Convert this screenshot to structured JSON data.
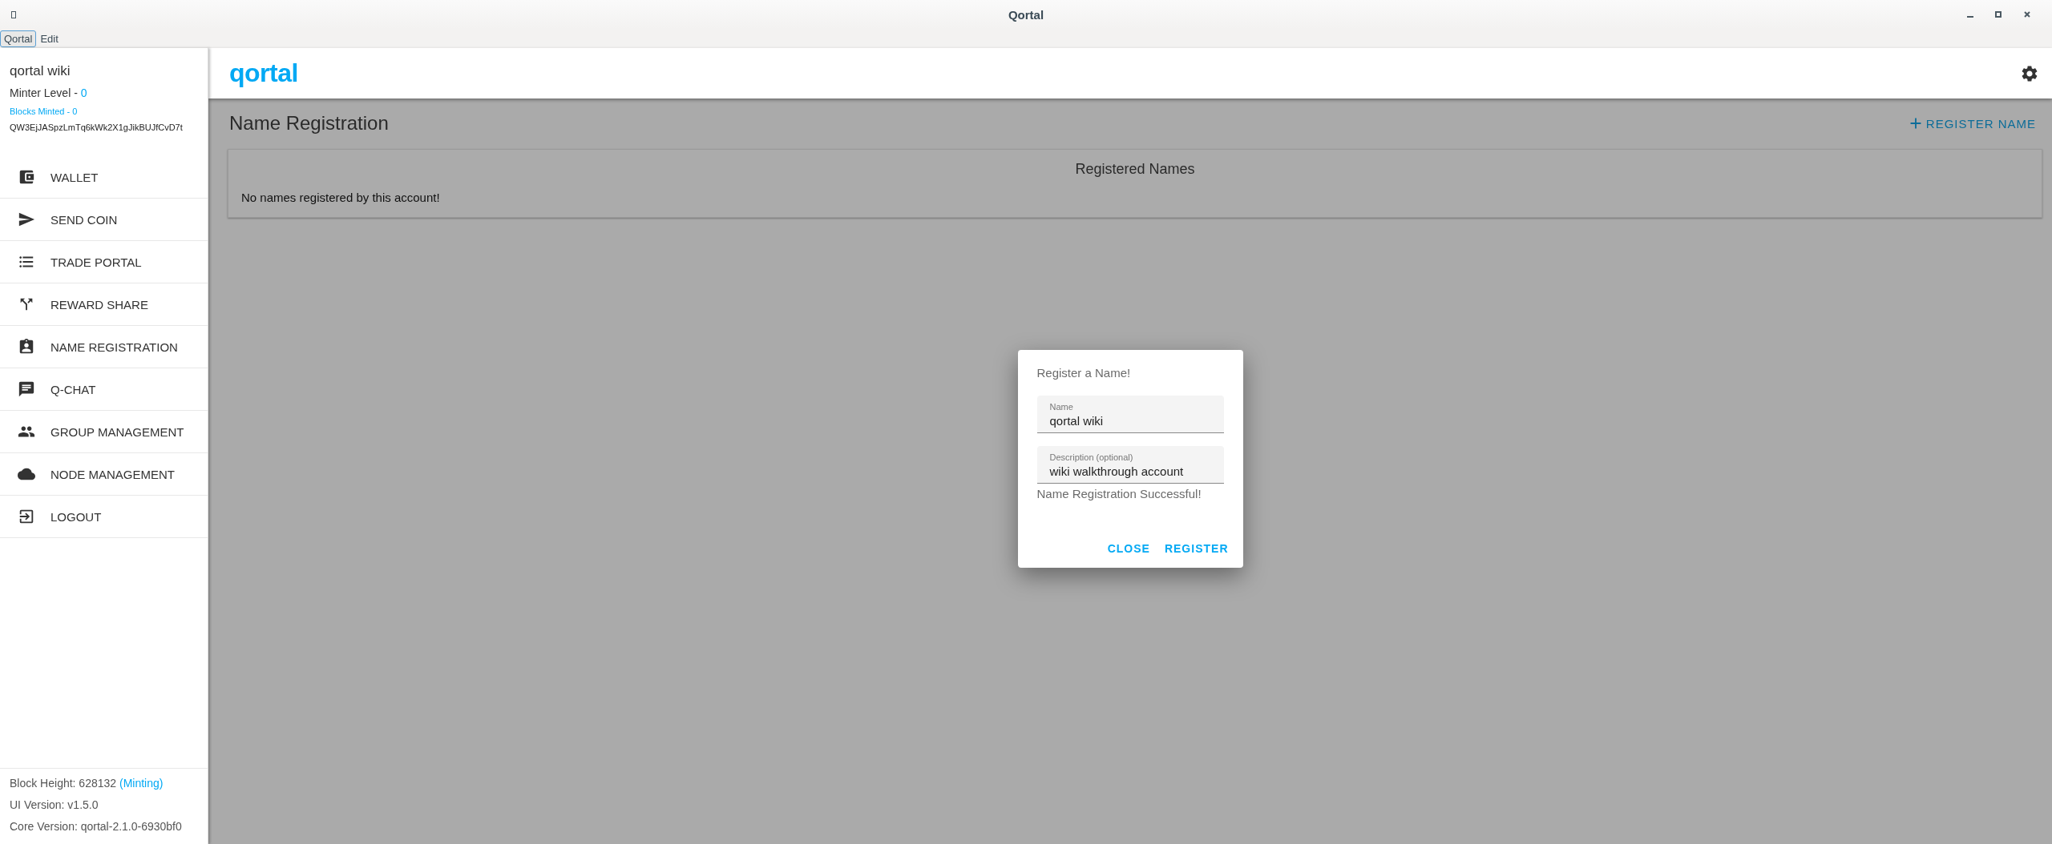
{
  "window": {
    "title": "Qortal"
  },
  "menu_bar": [
    {
      "label": "Qortal",
      "selected": true
    },
    {
      "label": "Edit",
      "selected": false
    }
  ],
  "sidebar": {
    "account_name": "qortal wiki",
    "minter_level_label": "Minter Level - ",
    "minter_level": "0",
    "blocks_minted": "Blocks Minted - 0",
    "address": "QW3EjJASpzLmTq6kWk2X1gJikBUJfCvD7t",
    "items": [
      {
        "kind": "wallet",
        "label": "WALLET"
      },
      {
        "kind": "send",
        "label": "SEND COIN"
      },
      {
        "kind": "trade",
        "label": "TRADE PORTAL"
      },
      {
        "kind": "reward",
        "label": "REWARD SHARE"
      },
      {
        "kind": "name",
        "label": "NAME REGISTRATION"
      },
      {
        "kind": "chat",
        "label": "Q-CHAT"
      },
      {
        "kind": "group",
        "label": "GROUP MANAGEMENT"
      },
      {
        "kind": "node",
        "label": "NODE MANAGEMENT"
      },
      {
        "kind": "logout",
        "label": "LOGOUT"
      }
    ],
    "footer": {
      "block_height": "Block Height: 628132",
      "minting": "(Minting)",
      "ui_version": "UI Version: v1.5.0",
      "core_version": "Core Version: qortal-2.1.0-6930bf0"
    }
  },
  "header": {
    "logo": "qortal"
  },
  "page": {
    "title": "Name Registration",
    "action": "REGISTER NAME",
    "card_title": "Registered Names",
    "empty_message": "No names registered by this account!"
  },
  "dialog": {
    "title": "Register a Name!",
    "fields": [
      {
        "label": "Name",
        "value": "qortal wiki"
      },
      {
        "label": "Description (optional)",
        "value": "wiki walkthrough account"
      }
    ],
    "message": "Name Registration Successful!",
    "buttons": [
      "CLOSE",
      "REGISTER"
    ]
  }
}
